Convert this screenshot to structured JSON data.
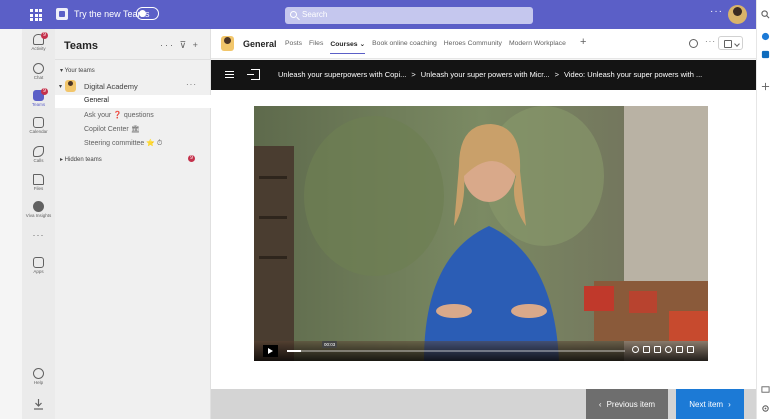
{
  "topbar": {
    "try_new_label": "Try the new Teams",
    "search_placeholder": "Search",
    "more_label": "···"
  },
  "rail": {
    "items": [
      {
        "label": "Activity",
        "badge": "9"
      },
      {
        "label": "Chat"
      },
      {
        "label": "Teams",
        "badge": "9"
      },
      {
        "label": "Calendar"
      },
      {
        "label": "Calls"
      },
      {
        "label": "Files"
      },
      {
        "label": "Viva Insights"
      },
      {
        "label": "Apps"
      }
    ],
    "more_label": "···",
    "help_label": "Help",
    "download_label": ""
  },
  "panel": {
    "title": "Teams",
    "actions": "··· ⊽ +",
    "your_teams_label": "▾ Your teams",
    "team_name": "Digital Academy",
    "team_more": "···",
    "channels": [
      {
        "name": "General",
        "selected": true
      },
      {
        "name": "Ask your ❓ questions"
      },
      {
        "name": "Copilot Center 🏛"
      },
      {
        "name": "Steering committee ⭐ ⏱"
      }
    ],
    "hidden_teams_label": "▸ Hidden teams",
    "hidden_badge": "9"
  },
  "header": {
    "title": "General",
    "tabs": [
      {
        "label": "Posts"
      },
      {
        "label": "Files"
      },
      {
        "label": "Courses ⌄",
        "active": true
      },
      {
        "label": "Book online coaching"
      },
      {
        "label": "Heroes Community"
      },
      {
        "label": "Modern Workplace"
      }
    ],
    "add_tab": "+",
    "more": "···"
  },
  "breadcrumbs": {
    "items": [
      "Unleash your superpowers with Copi...",
      "Unleash your super powers with Micr...",
      "Video: Unleash your super powers with ..."
    ],
    "separator": ">"
  },
  "video": {
    "current_time": "00:03",
    "progress_fraction": 0.04
  },
  "footer": {
    "prev_label": "Previous item",
    "next_label": "Next item"
  },
  "colors": {
    "accent": "#5b5fc7",
    "next_button": "#1c7ad6",
    "prev_button": "#6e6e6e",
    "badge": "#c4314b"
  }
}
